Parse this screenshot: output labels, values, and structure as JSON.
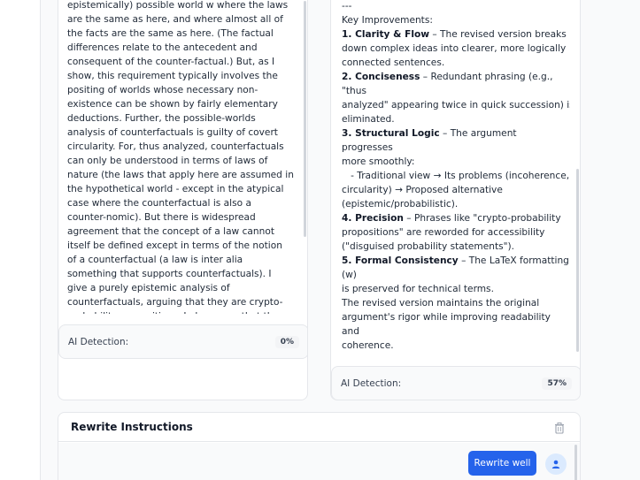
{
  "left_panel": {
    "lines": [
      "epistemically) possible world w where the laws",
      "are the same as here, and where almost all of",
      "the facts are the same as here. (The factual",
      "differences relate to the antecedent and",
      "consequent of the counter-factual.) But, as I",
      "show, this requirement typically involves the",
      "positing of worlds whose necessary non-",
      "existence can be shown by fairly elementary",
      "deductions. Further, the possible-worlds",
      "analysis of counterfactuals is guilty of covert",
      "circularity. For, thus analyzed, counterfactuals",
      "can only be understood in terms of laws of",
      "nature (the laws that apply here are assumed in",
      "the hypothetical world - except in the atypical",
      "case where the counterfactual is also a",
      "counter-nomic). But there is widespread",
      "agreement that the concept of a law cannot",
      "itself be defined except in terms of the notion",
      "of a counterfactual (a law is inter alia",
      "something that supports counterfactuals). I",
      "give a purely epistemic analysis of",
      "counterfactuals, arguing that they are crypto-",
      "probability propositions. I also argue that the"
    ],
    "ai_detection_label": "AI Detection:",
    "ai_detection_value": "0%"
  },
  "right_panel": {
    "separator": "---",
    "heading": "Key Improvements:",
    "items": [
      {
        "bold": "1. Clarity & Flow",
        "rest_first": " – The revised version breaks",
        "more": [
          "down complex ideas into clearer, more logically",
          "connected sentences."
        ]
      },
      {
        "bold": "2. Conciseness",
        "rest_first": " – Redundant phrasing (e.g., \"thus",
        "more": [
          "analyzed\" appearing twice in quick succession) is",
          "eliminated."
        ]
      },
      {
        "bold": "3. Structural Logic",
        "rest_first": " – The argument progresses",
        "more": [
          "more smoothly:",
          "   - Traditional view → Its problems (incoherence,",
          "circularity) → Proposed alternative",
          "(epistemic/probabilistic)."
        ]
      },
      {
        "bold": "4. Precision",
        "rest_first": " – Phrases like \"crypto-probability",
        "more": [
          "propositions\" are reworded for accessibility",
          "(\"disguised probability statements\")."
        ]
      },
      {
        "bold": "5. Formal Consistency",
        "rest_first": " – The LaTeX formatting (w)",
        "more": [
          "is preserved for technical terms."
        ]
      }
    ],
    "closing": [
      "The revised version maintains the original",
      "argument's rigor while improving readability and",
      "coherence."
    ],
    "ai_detection_label": "AI Detection:",
    "ai_detection_value": "57%"
  },
  "rewrite": {
    "title": "Rewrite Instructions",
    "button_label": "Rewrite well"
  },
  "icons": {
    "trash": "trash-icon",
    "user": "user-icon"
  },
  "colors": {
    "accent": "#2563eb",
    "background": "#f9fafb"
  }
}
